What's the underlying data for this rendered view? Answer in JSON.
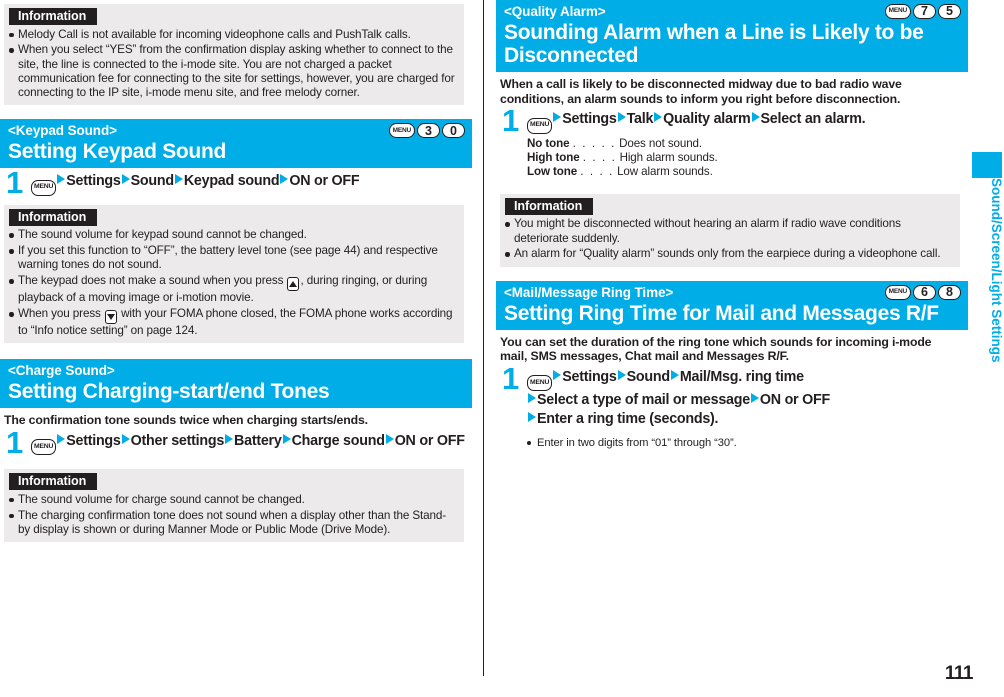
{
  "page": {
    "number": "111"
  },
  "side_tab": {
    "label": "Sound/Screen/Light Settings"
  },
  "left_column": {
    "top_info": {
      "label": "Information",
      "items": [
        "Melody Call is not available for incoming videophone calls and PushTalk calls.",
        "When you select “YES” from the confirmation display asking whether to connect to the site, the line is connected to the i-mode site. You are not charged a packet communication fee for connecting to the site for settings, however, you are charged for connecting to the IP site, i-mode menu site, and free melody corner."
      ]
    },
    "keypad_section": {
      "subtitle": "<Keypad Sound>",
      "title": "Setting Keypad Sound",
      "keys": [
        "MENU",
        "3",
        "0"
      ],
      "step": {
        "number": "1",
        "key": "MENU",
        "items": [
          "Settings",
          "Sound",
          "Keypad sound",
          "ON or OFF"
        ]
      },
      "info": {
        "label": "Information",
        "items": [
          "The sound volume for keypad sound cannot be changed.",
          "If you set this function to “OFF”, the battery level tone (see page 44) and respective warning tones do not sound.",
          "The keypad does not make a sound when you press ",
          "When you press "
        ],
        "item3_part1": "The keypad does not make a sound when you press",
        "item3_part2": ", during ringing, or during playback of a moving image or i-motion movie.",
        "item4_part1": "When you press",
        "item4_part2": "with your FOMA phone closed, the FOMA phone works according to “Info notice setting” on page 124."
      }
    },
    "charge_section": {
      "subtitle": "<Charge Sound>",
      "title": "Setting Charging-start/end Tones",
      "lead": "The confirmation tone sounds twice when charging starts/ends.",
      "step": {
        "number": "1",
        "key": "MENU",
        "items": [
          "Settings",
          "Other settings",
          "Battery",
          "Charge sound",
          "ON or OFF"
        ]
      },
      "info": {
        "label": "Information",
        "items": [
          "The sound volume for charge sound cannot be changed.",
          "The charging confirmation tone does not sound when a display other than the Stand-by display is shown or during Manner Mode or Public Mode (Drive Mode)."
        ]
      }
    }
  },
  "right_column": {
    "quality_section": {
      "subtitle": "<Quality Alarm>",
      "title": "Sounding Alarm when a Line is Likely to be Disconnected",
      "keys": [
        "MENU",
        "7",
        "5"
      ],
      "lead": "When a call is likely to be disconnected midway due to bad radio wave conditions, an alarm sounds to inform you right before disconnection.",
      "step": {
        "number": "1",
        "key": "MENU",
        "items": [
          "Settings",
          "Talk",
          "Quality alarm",
          "Select an alarm."
        ]
      },
      "definitions": [
        {
          "term": "No tone",
          "dots": ". . . . .",
          "desc": "Does not sound."
        },
        {
          "term": "High tone",
          "dots": ". . . .",
          "desc": "High alarm sounds."
        },
        {
          "term": "Low tone",
          "dots": ". . . .",
          "desc": "Low alarm sounds."
        }
      ],
      "info": {
        "label": "Information",
        "items": [
          "You might be disconnected without hearing an alarm if radio wave conditions deteriorate suddenly.",
          "An alarm for “Quality alarm” sounds only from the earpiece during a videophone call."
        ]
      }
    },
    "mail_section": {
      "subtitle": "<Mail/Message Ring Time>",
      "title": "Setting Ring Time for Mail and Messages R/F",
      "keys": [
        "MENU",
        "6",
        "8"
      ],
      "lead": "You can set the duration of the ring tone which sounds for incoming i-mode mail, SMS messages, Chat mail and Messages R/F.",
      "step": {
        "number": "1",
        "key": "MENU",
        "items": [
          "Settings",
          "Sound",
          "Mail/Msg. ring time",
          "Select a type of mail or message",
          "ON or OFF",
          "Enter a ring time (seconds)."
        ]
      },
      "note": "Enter in two digits from “01” through “30”."
    }
  },
  "colors": {
    "accent": "#00ade6",
    "ink": "#231f20",
    "info_bg": "#eceaea"
  }
}
